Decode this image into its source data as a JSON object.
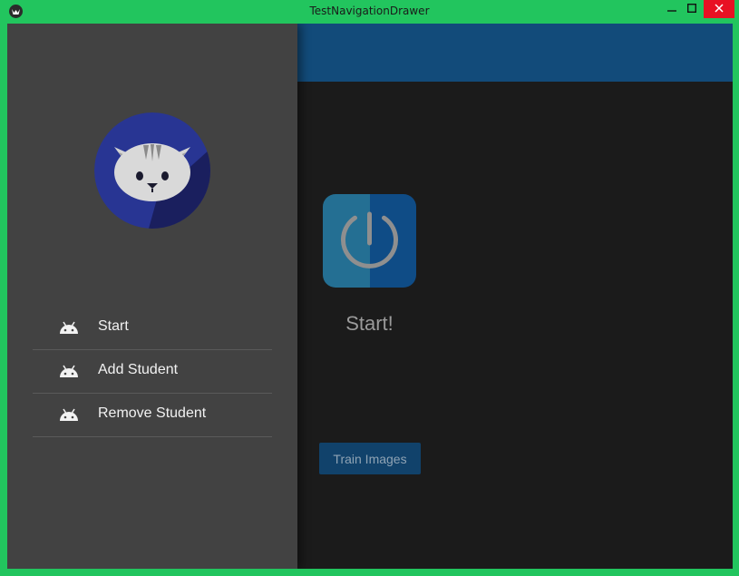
{
  "window": {
    "title": "TestNavigationDrawer",
    "minimize_icon": "minimize-icon",
    "maximize_icon": "maximize-icon",
    "close_icon": "close-icon"
  },
  "colors": {
    "accent": "#124b7a",
    "drawer_bg": "#424242",
    "main_bg": "#1b1b1b",
    "window_frame": "#22c55e"
  },
  "drawer": {
    "avatar_icon": "cat-avatar-icon",
    "items": [
      {
        "label": "Start",
        "icon": "android-icon"
      },
      {
        "label": "Add Student",
        "icon": "android-icon"
      },
      {
        "label": "Remove Student",
        "icon": "android-icon"
      }
    ]
  },
  "main": {
    "power_icon": "power-icon",
    "start_label": "Start!",
    "train_button_label": "Train Images"
  }
}
